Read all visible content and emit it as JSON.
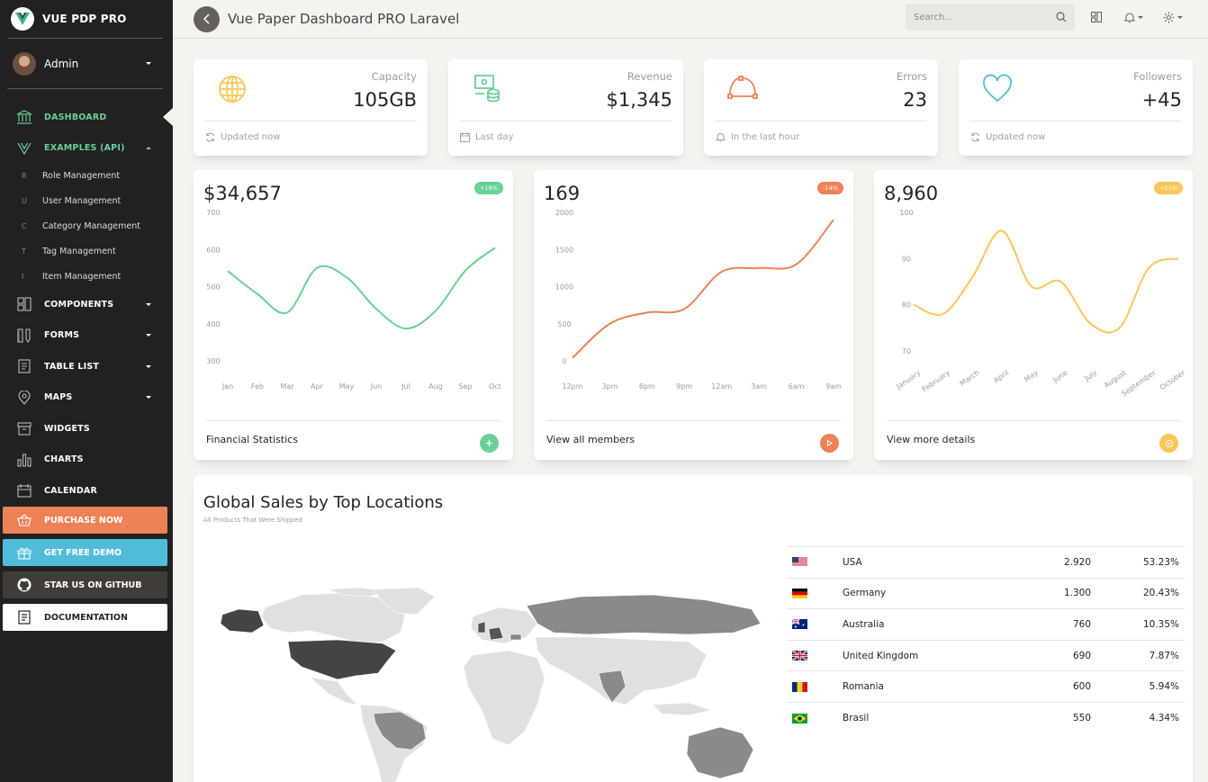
{
  "app": {
    "brand": "VUE PDP PRO",
    "page_title": "Vue Paper Dashboard PRO Laravel",
    "search_placeholder": "Search..."
  },
  "sidebar": {
    "user_name": "Admin",
    "nav": [
      {
        "label": "DASHBOARD",
        "icon": "bank-icon",
        "active": true
      },
      {
        "label": "EXAMPLES (API)",
        "icon": "vue-logo-icon",
        "expanded": true
      }
    ],
    "examples": [
      {
        "mini": "R",
        "label": "Role Management"
      },
      {
        "mini": "U",
        "label": "User Management"
      },
      {
        "mini": "C",
        "label": "Category Management"
      },
      {
        "mini": "T",
        "label": "Tag Management"
      },
      {
        "mini": "I",
        "label": "Item Management"
      }
    ],
    "nav_more": [
      {
        "label": "COMPONENTS",
        "icon": "layout-icon",
        "caret": true
      },
      {
        "label": "FORMS",
        "icon": "ruler-pencil-icon",
        "caret": true
      },
      {
        "label": "TABLE LIST",
        "icon": "paper-icon",
        "caret": true
      },
      {
        "label": "MAPS",
        "icon": "pin-icon",
        "caret": true
      },
      {
        "label": "WIDGETS",
        "icon": "box-icon",
        "caret": false
      },
      {
        "label": "CHARTS",
        "icon": "chart-bar-icon",
        "caret": false
      },
      {
        "label": "CALENDAR",
        "icon": "calendar-icon",
        "caret": false
      }
    ],
    "cta": [
      {
        "label": "PURCHASE NOW",
        "icon": "basket-icon",
        "color": "#ef8157"
      },
      {
        "label": "GET FREE DEMO",
        "icon": "gift-icon",
        "color": "#51bcda"
      },
      {
        "label": "STAR US ON GITHUB",
        "icon": "github-icon",
        "color": "#403d39"
      },
      {
        "label": "DOCUMENTATION",
        "icon": "paper-icon",
        "color": "#ffffff"
      }
    ]
  },
  "stats": [
    {
      "label": "Capacity",
      "value": "105GB",
      "footer": "Updated now",
      "icon": "globe-icon",
      "icon_color": "#fbc658",
      "footer_icon": "refresh-icon"
    },
    {
      "label": "Revenue",
      "value": "$1,345",
      "footer": "Last day",
      "icon": "money-coins-icon",
      "icon_color": "#6bd098",
      "footer_icon": "calendar-icon"
    },
    {
      "label": "Errors",
      "value": "23",
      "footer": "In the last hour",
      "icon": "vector-icon",
      "icon_color": "#ef8157",
      "footer_icon": "bell-icon"
    },
    {
      "label": "Followers",
      "value": "+45",
      "footer": "Updated now",
      "icon": "heart-icon",
      "icon_color": "#51bcda",
      "footer_icon": "refresh-icon"
    }
  ],
  "chart_cards": [
    {
      "big": "$34,657",
      "badge": "+18%",
      "color": "#6bd098",
      "footer": "Financial Statistics",
      "button_icon": "plus-icon"
    },
    {
      "big": "169",
      "badge": "-14%",
      "color": "#ef8157",
      "footer": "View all members",
      "button_icon": "play-icon"
    },
    {
      "big": "8,960",
      "badge": "+51%",
      "color": "#fbc658",
      "footer": "View more details",
      "button_icon": "target-icon"
    }
  ],
  "chart_data": [
    {
      "type": "line",
      "categories": [
        "Jan",
        "Feb",
        "Mar",
        "Apr",
        "May",
        "Jun",
        "Jul",
        "Aug",
        "Sep",
        "Oct"
      ],
      "values": [
        542,
        480,
        430,
        550,
        525,
        440,
        387,
        435,
        543,
        605
      ],
      "ylim": [
        300,
        700
      ],
      "yticks": [
        300,
        400,
        500,
        600,
        700
      ],
      "color": "#6bd098"
    },
    {
      "type": "line",
      "categories": [
        "12pm",
        "3pm",
        "6pm",
        "9pm",
        "12am",
        "3am",
        "6am",
        "9am"
      ],
      "values": [
        40,
        500,
        650,
        700,
        1200,
        1250,
        1300,
        1900
      ],
      "ylim": [
        0,
        2000
      ],
      "yticks": [
        0,
        500,
        1000,
        1500,
        2000
      ],
      "color": "#ef8157"
    },
    {
      "type": "line",
      "categories": [
        "January",
        "February",
        "March",
        "April",
        "May",
        "June",
        "July",
        "August",
        "September",
        "October"
      ],
      "values": [
        80,
        78,
        86,
        96,
        84,
        85,
        76,
        75,
        88,
        90
      ],
      "ylim": [
        70,
        100
      ],
      "yticks": [
        70,
        80,
        90,
        100
      ],
      "color": "#fbc658"
    }
  ],
  "sales": {
    "title": "Global Sales by Top Locations",
    "subtitle": "All Products That Were Shipped",
    "rows": [
      {
        "country": "USA",
        "flag": "us-flag-icon",
        "sales": "2.920",
        "percent": "53.23%"
      },
      {
        "country": "Germany",
        "flag": "de-flag-icon",
        "sales": "1.300",
        "percent": "20.43%"
      },
      {
        "country": "Australia",
        "flag": "au-flag-icon",
        "sales": "760",
        "percent": "10.35%"
      },
      {
        "country": "United Kingdom",
        "flag": "gb-flag-icon",
        "sales": "690",
        "percent": "7.87%"
      },
      {
        "country": "Romania",
        "flag": "ro-flag-icon",
        "sales": "600",
        "percent": "5.94%"
      },
      {
        "country": "Brasil",
        "flag": "br-flag-icon",
        "sales": "550",
        "percent": "4.34%"
      }
    ]
  }
}
